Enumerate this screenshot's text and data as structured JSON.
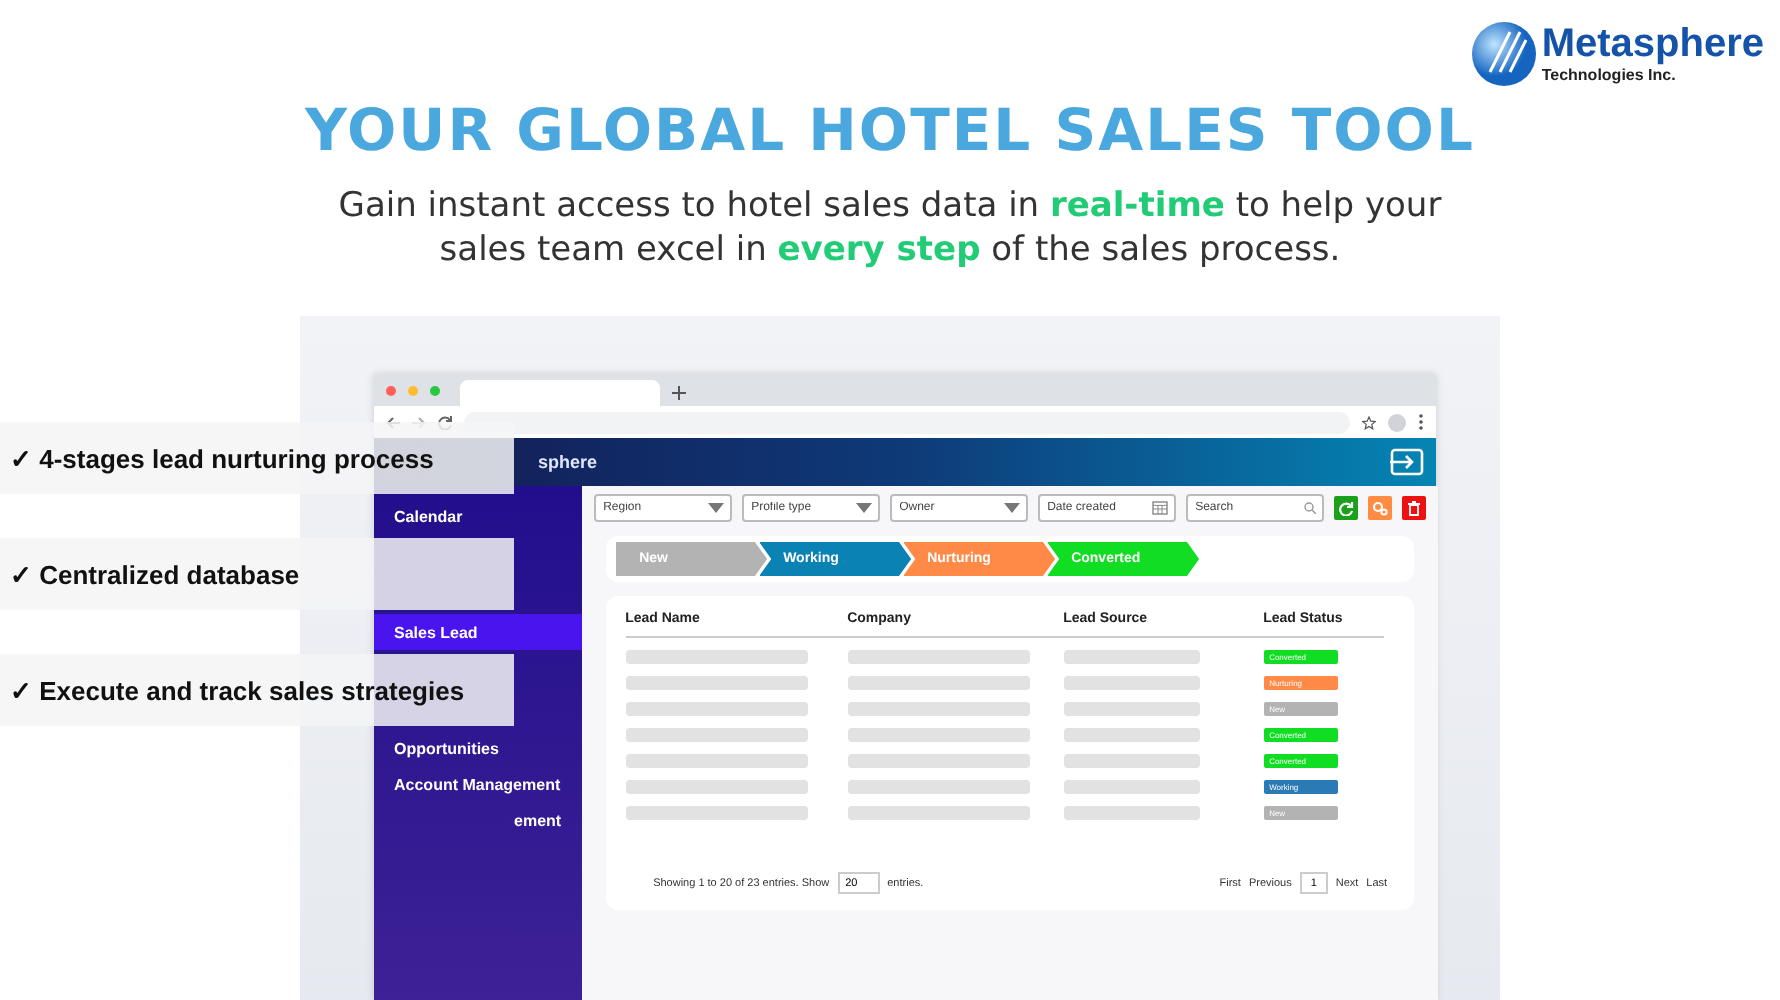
{
  "brand": {
    "name": "Metasphere",
    "tagline": "Technologies Inc."
  },
  "headline": "YOUR GLOBAL HOTEL SALES TOOL",
  "subtitle": "Gain instant access to hotel sales data in **real-time** to help your sales team excel in **every step** of the sales process.",
  "features": [
    "✓ 4-stages lead nurturing process",
    "✓ Centralized database",
    "✓ Execute and track sales strategies"
  ],
  "app": {
    "logo_text": "sphere",
    "sidebar": {
      "items": [
        {
          "label": "Calendar",
          "selected": false
        },
        {
          "label": "Sales Lead",
          "selected": true
        },
        {
          "label": "Opportunities",
          "selected": false
        },
        {
          "label": "Account Management",
          "selected": false
        },
        {
          "label": "ement",
          "selected": false
        }
      ]
    },
    "filters": [
      {
        "kind": "dropdown",
        "placeholder": "Region"
      },
      {
        "kind": "dropdown",
        "placeholder": "Profile type"
      },
      {
        "kind": "dropdown",
        "placeholder": "Owner"
      },
      {
        "kind": "date",
        "placeholder": "Date created"
      },
      {
        "kind": "search",
        "placeholder": "Search"
      }
    ],
    "actions": [
      {
        "kind": "refresh",
        "color": "#1aa01a"
      },
      {
        "kind": "settings",
        "color": "#ff8c42"
      },
      {
        "kind": "delete",
        "color": "#ee1111"
      }
    ],
    "stages": [
      {
        "label": "New",
        "color": "#b3b3b3"
      },
      {
        "label": "Working",
        "color": "#0a82b4"
      },
      {
        "label": "Nurturing",
        "color": "#ff8a48"
      },
      {
        "label": "Converted",
        "color": "#11dd22"
      }
    ],
    "table": {
      "columns": [
        "Lead Name",
        "Company",
        "Lead Source",
        "Lead Status"
      ],
      "rows": [
        {
          "status": "Converted",
          "color": "#11dd22"
        },
        {
          "status": "Nurturing",
          "color": "#ff8a48"
        },
        {
          "status": "New",
          "color": "#b3b3b3"
        },
        {
          "status": "Converted",
          "color": "#11dd22"
        },
        {
          "status": "Converted",
          "color": "#11dd22"
        },
        {
          "status": "Working",
          "color": "#2a7ab5"
        },
        {
          "status": "New",
          "color": "#b3b3b3"
        }
      ]
    },
    "footer": {
      "showing": "Showing 1 to 20 of 23 entries. Show",
      "page_size": "20",
      "entries": "entries.",
      "first": "First",
      "previous": "Previous",
      "page": "1",
      "next": "Next",
      "last": "Last"
    }
  }
}
